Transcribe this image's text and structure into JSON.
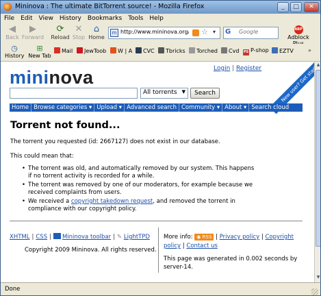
{
  "window": {
    "title": "Mininova : The ultimate BitTorrent source! - Mozilla Firefox",
    "controls": [
      "_",
      "□",
      "✕"
    ]
  },
  "menu": [
    "File",
    "Edit",
    "View",
    "History",
    "Bookmarks",
    "Tools",
    "Help"
  ],
  "nav": {
    "back": "Back",
    "forward": "Forward",
    "reload": "Reload",
    "stop": "Stop",
    "home": "Home",
    "url": "http://www.mininova.org/tc",
    "search_placeholder": "Google",
    "adblock": "Adblock Plus",
    "adblock_badge": "ABP",
    "site_icon": "m",
    "search_engine": "G"
  },
  "bookmarks": [
    {
      "label": "History",
      "icon": "history-icon"
    },
    {
      "label": "New Tab",
      "icon": "new-tab-icon"
    },
    {
      "label": "Mail",
      "icon": "mail-icon",
      "color": "#d93025"
    },
    {
      "label": "JewToob",
      "icon": "youtube-icon",
      "color": "#cc181e"
    },
    {
      "label": "W | A",
      "icon": "wolfram-icon",
      "color": "#e0531b"
    },
    {
      "label": "CVC",
      "icon": "cvc-icon",
      "color": "#2b3a55"
    },
    {
      "label": "Tbricks",
      "icon": "tbricks-icon",
      "color": "#555555"
    },
    {
      "label": "Torched",
      "icon": "torched-icon",
      "color": "#999999"
    },
    {
      "label": "Cvd",
      "icon": "cvd-icon",
      "color": "#777777"
    },
    {
      "label": "P-shop",
      "icon": "photoshop-icon",
      "color": "#c0392b",
      "badge": "PS"
    },
    {
      "label": "EZTV",
      "icon": "eztv-icon",
      "color": "#3b6fb6"
    }
  ],
  "page": {
    "logo": {
      "mini": "mini",
      "nova": "nova"
    },
    "login": "Login",
    "register": "Register",
    "banner": "New user? Get started!",
    "search_value": "",
    "category": "All torrents",
    "search_button": "Search",
    "navlinks": [
      "Home",
      "Browse categories ▾",
      "Upload ▾",
      "Advanced search",
      "Community ▾",
      "About ▾",
      "Search cloud"
    ],
    "heading": "Torrent not found...",
    "para1": "The torrent you requested (id: 2667127) does not exist in our database.",
    "para2": "This could mean that:",
    "reason1": "The torrent was old, and automatically removed by our system. This happens if no torrent activity is recorded for a while.",
    "reason2": "The torrent was removed by one of our moderators, for example because we received complaints from users.",
    "reason3_pre": "We received a ",
    "reason3_link": "copyright takedown request",
    "reason3_post": ", and removed the torrent in compliance with our copyright policy.",
    "footer": {
      "xhtml": "XHTML",
      "css": "CSS",
      "toolbar": "Mininova toolbar",
      "lighttpd": "LightTPD",
      "copyright": "Copyright 2009 Mininova. All rights reserved.",
      "more_info": "More info:",
      "rss": "RSS",
      "privacy": "Privacy policy",
      "copyright_link": "Copyright policy",
      "contact": "Contact us",
      "generated": "This page was generated in 0.002 seconds by server-14."
    }
  },
  "status": "Done"
}
